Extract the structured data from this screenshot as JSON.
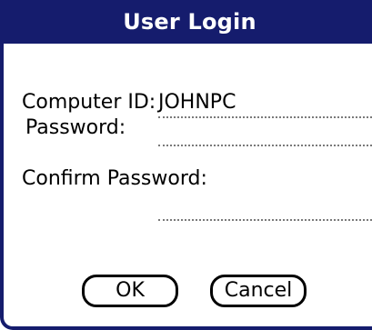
{
  "dialog": {
    "title": "User Login"
  },
  "form": {
    "computer_id_label": "Computer ID:",
    "computer_id_value": "JOHNPC",
    "password_label": "Password:",
    "password_value": "",
    "confirm_password_label": "Confirm Password:",
    "confirm_password_value": ""
  },
  "buttons": {
    "ok_label": "OK",
    "cancel_label": "Cancel"
  },
  "colors": {
    "title_bar": "#151c6d",
    "background": "#ffffff"
  }
}
